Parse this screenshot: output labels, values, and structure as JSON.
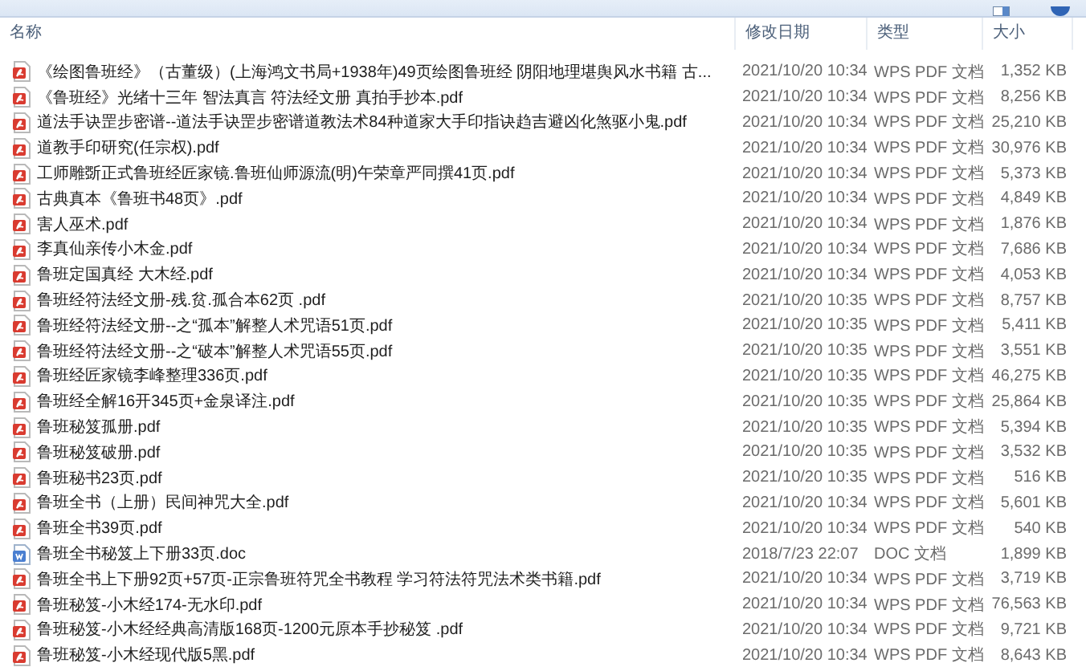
{
  "columns": [
    {
      "label": "名称"
    },
    {
      "label": "修改日期"
    },
    {
      "label": "类型"
    },
    {
      "label": "大小"
    }
  ],
  "files": [
    {
      "name": "《绘图鲁班经》（古董级）(上海鸿文书局+1938年)49页绘图鲁班经 阴阳地理堪舆风水书籍 古...",
      "modified": "2021/10/20 10:34",
      "type": "WPS PDF 文档",
      "size": "1,352 KB",
      "kind": "pdf"
    },
    {
      "name": "《鲁班经》光绪十三年 智法真言 符法经文册 真拍手抄本.pdf",
      "modified": "2021/10/20 10:34",
      "type": "WPS PDF 文档",
      "size": "8,256 KB",
      "kind": "pdf"
    },
    {
      "name": "道法手诀罡步密谱--道法手诀罡步密谱道教法术84种道家大手印指诀趋吉避凶化煞驱小鬼.pdf",
      "modified": "2021/10/20 10:34",
      "type": "WPS PDF 文档",
      "size": "25,210 KB",
      "kind": "pdf"
    },
    {
      "name": "道教手印研究(任宗权).pdf",
      "modified": "2021/10/20 10:34",
      "type": "WPS PDF 文档",
      "size": "30,976 KB",
      "kind": "pdf"
    },
    {
      "name": "工师雕斲正式鲁班经匠家镜.鲁班仙师源流(明)午荣章严同撰41页.pdf",
      "modified": "2021/10/20 10:34",
      "type": "WPS PDF 文档",
      "size": "5,373 KB",
      "kind": "pdf"
    },
    {
      "name": "古典真本《鲁班书48页》.pdf",
      "modified": "2021/10/20 10:34",
      "type": "WPS PDF 文档",
      "size": "4,849 KB",
      "kind": "pdf"
    },
    {
      "name": "害人巫术.pdf",
      "modified": "2021/10/20 10:34",
      "type": "WPS PDF 文档",
      "size": "1,876 KB",
      "kind": "pdf"
    },
    {
      "name": "李真仙亲传小木金.pdf",
      "modified": "2021/10/20 10:34",
      "type": "WPS PDF 文档",
      "size": "7,686 KB",
      "kind": "pdf"
    },
    {
      "name": "鲁班定国真经 大木经.pdf",
      "modified": "2021/10/20 10:34",
      "type": "WPS PDF 文档",
      "size": "4,053 KB",
      "kind": "pdf"
    },
    {
      "name": "鲁班经符法经文册-残.贫.孤合本62页 .pdf",
      "modified": "2021/10/20 10:35",
      "type": "WPS PDF 文档",
      "size": "8,757 KB",
      "kind": "pdf"
    },
    {
      "name": "鲁班经符法经文册--之“孤本”解整人术咒语51页.pdf",
      "modified": "2021/10/20 10:35",
      "type": "WPS PDF 文档",
      "size": "5,411 KB",
      "kind": "pdf"
    },
    {
      "name": "鲁班经符法经文册--之“破本”解整人术咒语55页.pdf",
      "modified": "2021/10/20 10:35",
      "type": "WPS PDF 文档",
      "size": "3,551 KB",
      "kind": "pdf"
    },
    {
      "name": "鲁班经匠家镜李峰整理336页.pdf",
      "modified": "2021/10/20 10:35",
      "type": "WPS PDF 文档",
      "size": "46,275 KB",
      "kind": "pdf"
    },
    {
      "name": "鲁班经全解16开345页+金泉译注.pdf",
      "modified": "2021/10/20 10:35",
      "type": "WPS PDF 文档",
      "size": "25,864 KB",
      "kind": "pdf"
    },
    {
      "name": "鲁班秘笈孤册.pdf",
      "modified": "2021/10/20 10:35",
      "type": "WPS PDF 文档",
      "size": "5,394 KB",
      "kind": "pdf"
    },
    {
      "name": "鲁班秘笈破册.pdf",
      "modified": "2021/10/20 10:35",
      "type": "WPS PDF 文档",
      "size": "3,532 KB",
      "kind": "pdf"
    },
    {
      "name": "鲁班秘书23页.pdf",
      "modified": "2021/10/20 10:35",
      "type": "WPS PDF 文档",
      "size": "516 KB",
      "kind": "pdf"
    },
    {
      "name": "鲁班全书（上册）民间神咒大全.pdf",
      "modified": "2021/10/20 10:34",
      "type": "WPS PDF 文档",
      "size": "5,601 KB",
      "kind": "pdf"
    },
    {
      "name": "鲁班全书39页.pdf",
      "modified": "2021/10/20 10:34",
      "type": "WPS PDF 文档",
      "size": "540 KB",
      "kind": "pdf"
    },
    {
      "name": "鲁班全书秘笈上下册33页.doc",
      "modified": "2018/7/23 22:07",
      "type": "DOC 文档",
      "size": "1,899 KB",
      "kind": "doc"
    },
    {
      "name": "鲁班全书上下册92页+57页-正宗鲁班符咒全书教程 学习符法符咒法术类书籍.pdf",
      "modified": "2021/10/20 10:34",
      "type": "WPS PDF 文档",
      "size": "3,719 KB",
      "kind": "pdf"
    },
    {
      "name": "鲁班秘笈-小木经174-无水印.pdf",
      "modified": "2021/10/20 10:34",
      "type": "WPS PDF 文档",
      "size": "76,563 KB",
      "kind": "pdf"
    },
    {
      "name": "鲁班秘笈-小木经经典高清版168页-1200元原本手抄秘笈  .pdf",
      "modified": "2021/10/20 10:34",
      "type": "WPS PDF 文档",
      "size": "9,721 KB",
      "kind": "pdf"
    },
    {
      "name": "鲁班秘笈-小木经现代版5黑.pdf",
      "modified": "2021/10/20 10:34",
      "type": "WPS PDF 文档",
      "size": "8,643 KB",
      "kind": "pdf"
    }
  ]
}
